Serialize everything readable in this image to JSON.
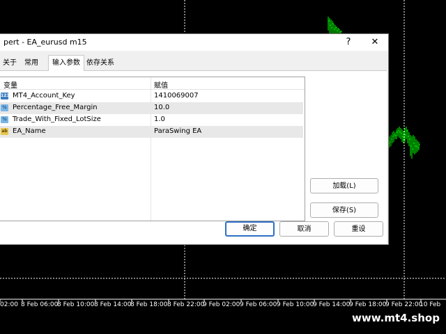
{
  "chart": {
    "x_axis_labels": [
      "02:00",
      "8 Feb 06:00",
      "8 Feb 10:00",
      "8 Feb 14:00",
      "8 Feb 18:00",
      "8 Feb 22:00",
      "9 Feb 02:00",
      "9 Feb 06:00",
      "9 Feb 10:00",
      "9 Feb 14:00",
      "9 Feb 18:00",
      "9 Feb 22:00",
      "10 Feb"
    ],
    "colors": {
      "background": "#000000",
      "candle": "#00ff00",
      "grid": "#ffffff"
    }
  },
  "watermark": "www.mt4.shop",
  "dialog": {
    "title": "pert - EA_eurusd m15",
    "help_button": "?",
    "close_button": "✕",
    "tabs": [
      {
        "label": "关于",
        "active": false
      },
      {
        "label": "常用",
        "active": false
      },
      {
        "label": "输入参数",
        "active": true
      },
      {
        "label": "依存关系",
        "active": false
      }
    ],
    "grid": {
      "headers": [
        "变量",
        "赋值"
      ],
      "rows": [
        {
          "type": "int",
          "icon_text": "123",
          "name": "MT4_Account_Key",
          "value": "1410069007"
        },
        {
          "type": "double",
          "icon_text": "½",
          "name": "Percentage_Free_Margin",
          "value": "10.0"
        },
        {
          "type": "double",
          "icon_text": "½",
          "name": "Trade_With_Fixed_LotSize",
          "value": "1.0"
        },
        {
          "type": "string",
          "icon_text": "ab",
          "name": "EA_Name",
          "value": "ParaSwing EA"
        }
      ]
    },
    "buttons": {
      "load": "加载(L)",
      "save": "保存(S)",
      "ok": "确定",
      "cancel": "取消",
      "reset": "重设"
    }
  }
}
